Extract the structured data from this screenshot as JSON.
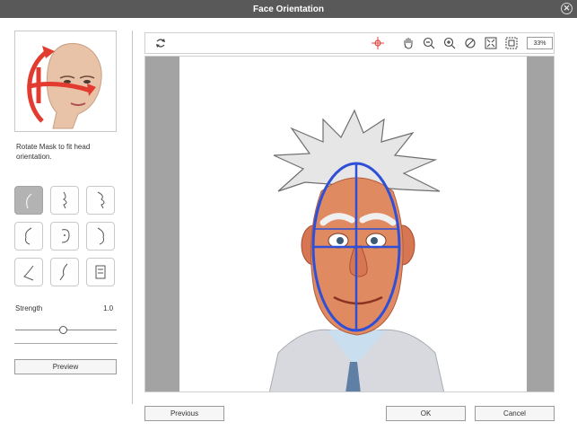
{
  "window": {
    "title": "Face Orientation",
    "close_icon": "close-icon"
  },
  "left_panel": {
    "preview_icon": "head-rotation-preview-icon",
    "instructions": "Rotate Mask to fit head orientation.",
    "orientation_buttons": [
      {
        "icon": "face-profile-front-icon",
        "active": true
      },
      {
        "icon": "face-profile-right-icon",
        "active": false
      },
      {
        "icon": "face-profile-right-tilt-icon",
        "active": false
      },
      {
        "icon": "face-left-icon",
        "active": false
      },
      {
        "icon": "face-three-quarter-icon",
        "active": false
      },
      {
        "icon": "face-right-icon",
        "active": false
      },
      {
        "icon": "face-down-left-icon",
        "active": false
      },
      {
        "icon": "face-down-icon",
        "active": false
      },
      {
        "icon": "face-down-right-icon",
        "active": false
      }
    ],
    "strength": {
      "label": "Strength",
      "value": "1.0",
      "slider_fraction": 0.48
    },
    "preview_button": "Preview"
  },
  "toolbar": {
    "zoom": "33%",
    "icons": [
      "rotate-reset-icon",
      "target-icon",
      "hand-pan-icon",
      "zoom-out-icon",
      "zoom-in-icon",
      "zoom-reset-icon",
      "fit-screen-icon",
      "fit-selection-icon"
    ]
  },
  "footer": {
    "previous": "Previous",
    "ok": "OK",
    "cancel": "Cancel"
  },
  "colors": {
    "title_bar": "#595959",
    "mask_outline": "#2e4fd6",
    "target_icon": "#e0463c",
    "active_button": "#b3b3b3"
  }
}
